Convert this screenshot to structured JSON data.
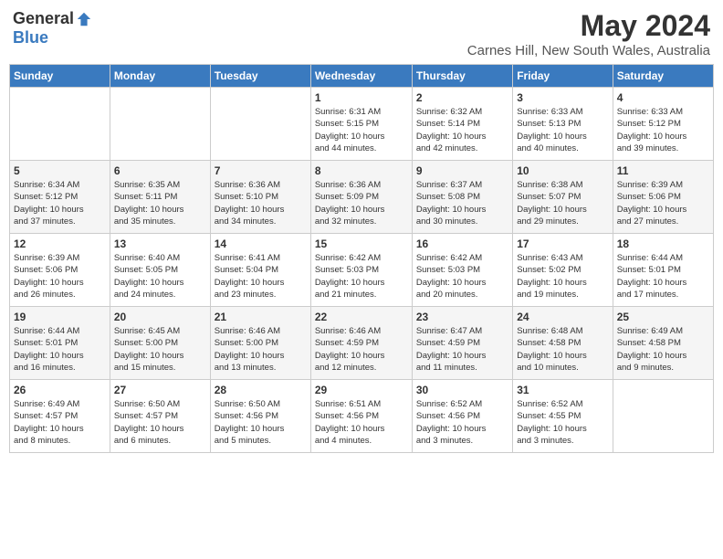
{
  "logo": {
    "general": "General",
    "blue": "Blue"
  },
  "header": {
    "month_title": "May 2024",
    "location": "Carnes Hill, New South Wales, Australia"
  },
  "days_of_week": [
    "Sunday",
    "Monday",
    "Tuesday",
    "Wednesday",
    "Thursday",
    "Friday",
    "Saturday"
  ],
  "weeks": [
    [
      {
        "day": "",
        "info": ""
      },
      {
        "day": "",
        "info": ""
      },
      {
        "day": "",
        "info": ""
      },
      {
        "day": "1",
        "info": "Sunrise: 6:31 AM\nSunset: 5:15 PM\nDaylight: 10 hours\nand 44 minutes."
      },
      {
        "day": "2",
        "info": "Sunrise: 6:32 AM\nSunset: 5:14 PM\nDaylight: 10 hours\nand 42 minutes."
      },
      {
        "day": "3",
        "info": "Sunrise: 6:33 AM\nSunset: 5:13 PM\nDaylight: 10 hours\nand 40 minutes."
      },
      {
        "day": "4",
        "info": "Sunrise: 6:33 AM\nSunset: 5:12 PM\nDaylight: 10 hours\nand 39 minutes."
      }
    ],
    [
      {
        "day": "5",
        "info": "Sunrise: 6:34 AM\nSunset: 5:12 PM\nDaylight: 10 hours\nand 37 minutes."
      },
      {
        "day": "6",
        "info": "Sunrise: 6:35 AM\nSunset: 5:11 PM\nDaylight: 10 hours\nand 35 minutes."
      },
      {
        "day": "7",
        "info": "Sunrise: 6:36 AM\nSunset: 5:10 PM\nDaylight: 10 hours\nand 34 minutes."
      },
      {
        "day": "8",
        "info": "Sunrise: 6:36 AM\nSunset: 5:09 PM\nDaylight: 10 hours\nand 32 minutes."
      },
      {
        "day": "9",
        "info": "Sunrise: 6:37 AM\nSunset: 5:08 PM\nDaylight: 10 hours\nand 30 minutes."
      },
      {
        "day": "10",
        "info": "Sunrise: 6:38 AM\nSunset: 5:07 PM\nDaylight: 10 hours\nand 29 minutes."
      },
      {
        "day": "11",
        "info": "Sunrise: 6:39 AM\nSunset: 5:06 PM\nDaylight: 10 hours\nand 27 minutes."
      }
    ],
    [
      {
        "day": "12",
        "info": "Sunrise: 6:39 AM\nSunset: 5:06 PM\nDaylight: 10 hours\nand 26 minutes."
      },
      {
        "day": "13",
        "info": "Sunrise: 6:40 AM\nSunset: 5:05 PM\nDaylight: 10 hours\nand 24 minutes."
      },
      {
        "day": "14",
        "info": "Sunrise: 6:41 AM\nSunset: 5:04 PM\nDaylight: 10 hours\nand 23 minutes."
      },
      {
        "day": "15",
        "info": "Sunrise: 6:42 AM\nSunset: 5:03 PM\nDaylight: 10 hours\nand 21 minutes."
      },
      {
        "day": "16",
        "info": "Sunrise: 6:42 AM\nSunset: 5:03 PM\nDaylight: 10 hours\nand 20 minutes."
      },
      {
        "day": "17",
        "info": "Sunrise: 6:43 AM\nSunset: 5:02 PM\nDaylight: 10 hours\nand 19 minutes."
      },
      {
        "day": "18",
        "info": "Sunrise: 6:44 AM\nSunset: 5:01 PM\nDaylight: 10 hours\nand 17 minutes."
      }
    ],
    [
      {
        "day": "19",
        "info": "Sunrise: 6:44 AM\nSunset: 5:01 PM\nDaylight: 10 hours\nand 16 minutes."
      },
      {
        "day": "20",
        "info": "Sunrise: 6:45 AM\nSunset: 5:00 PM\nDaylight: 10 hours\nand 15 minutes."
      },
      {
        "day": "21",
        "info": "Sunrise: 6:46 AM\nSunset: 5:00 PM\nDaylight: 10 hours\nand 13 minutes."
      },
      {
        "day": "22",
        "info": "Sunrise: 6:46 AM\nSunset: 4:59 PM\nDaylight: 10 hours\nand 12 minutes."
      },
      {
        "day": "23",
        "info": "Sunrise: 6:47 AM\nSunset: 4:59 PM\nDaylight: 10 hours\nand 11 minutes."
      },
      {
        "day": "24",
        "info": "Sunrise: 6:48 AM\nSunset: 4:58 PM\nDaylight: 10 hours\nand 10 minutes."
      },
      {
        "day": "25",
        "info": "Sunrise: 6:49 AM\nSunset: 4:58 PM\nDaylight: 10 hours\nand 9 minutes."
      }
    ],
    [
      {
        "day": "26",
        "info": "Sunrise: 6:49 AM\nSunset: 4:57 PM\nDaylight: 10 hours\nand 8 minutes."
      },
      {
        "day": "27",
        "info": "Sunrise: 6:50 AM\nSunset: 4:57 PM\nDaylight: 10 hours\nand 6 minutes."
      },
      {
        "day": "28",
        "info": "Sunrise: 6:50 AM\nSunset: 4:56 PM\nDaylight: 10 hours\nand 5 minutes."
      },
      {
        "day": "29",
        "info": "Sunrise: 6:51 AM\nSunset: 4:56 PM\nDaylight: 10 hours\nand 4 minutes."
      },
      {
        "day": "30",
        "info": "Sunrise: 6:52 AM\nSunset: 4:56 PM\nDaylight: 10 hours\nand 3 minutes."
      },
      {
        "day": "31",
        "info": "Sunrise: 6:52 AM\nSunset: 4:55 PM\nDaylight: 10 hours\nand 3 minutes."
      },
      {
        "day": "",
        "info": ""
      }
    ]
  ]
}
